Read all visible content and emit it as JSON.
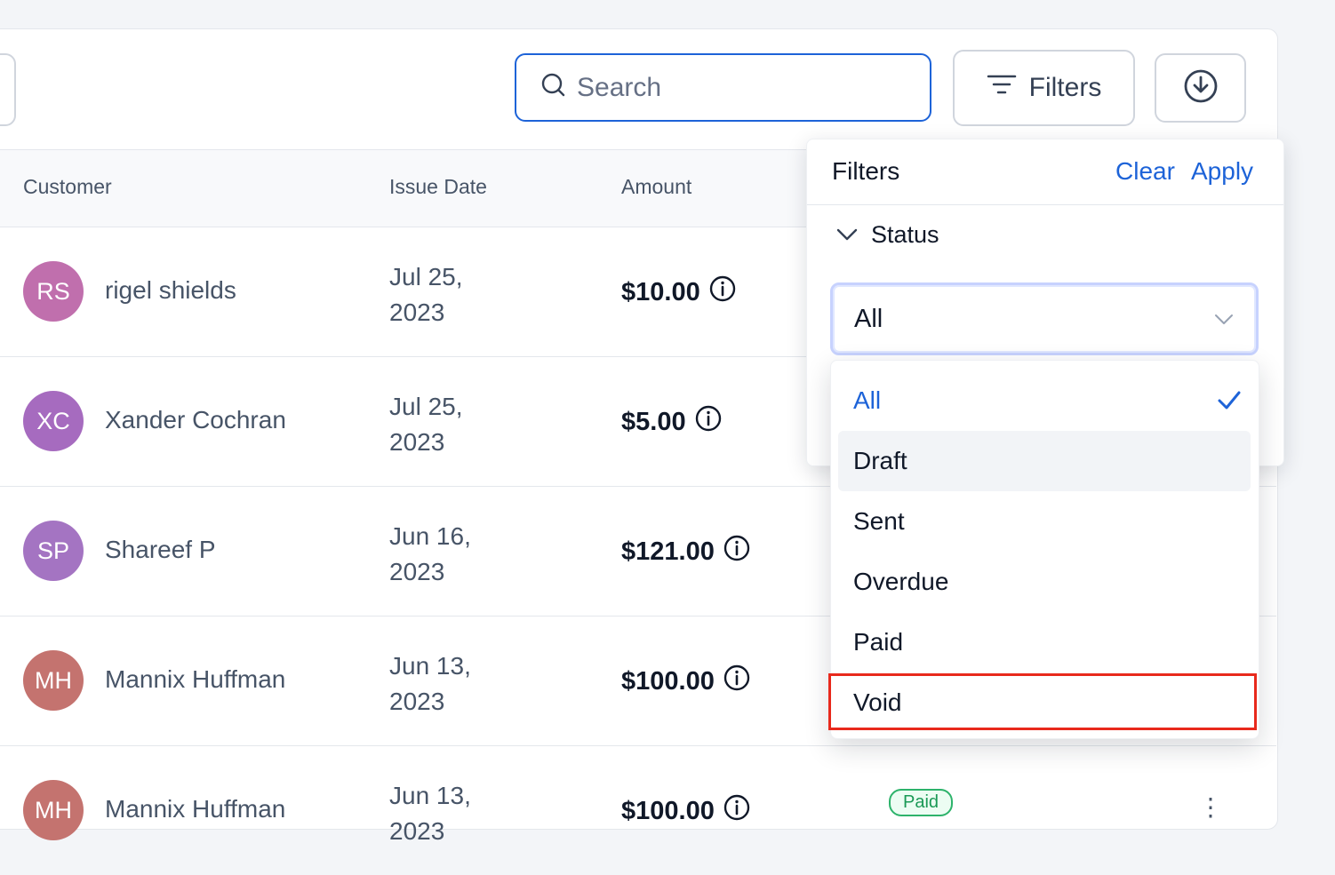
{
  "toolbar": {
    "search_placeholder": "Search",
    "filters_label": "Filters"
  },
  "table": {
    "columns": [
      "Customer",
      "Issue Date",
      "Amount"
    ],
    "rows": [
      {
        "initials": "RS",
        "name": "rigel shields",
        "date_line1": "Jul 25,",
        "date_line2": "2023",
        "amount": "$10.00",
        "avatar_color": "#c06fad"
      },
      {
        "initials": "XC",
        "name": "Xander Cochran",
        "date_line1": "Jul 25,",
        "date_line2": "2023",
        "amount": "$5.00",
        "avatar_color": "#a66bbf"
      },
      {
        "initials": "SP",
        "name": "Shareef P",
        "date_line1": "Jun 16,",
        "date_line2": "2023",
        "amount": "$121.00",
        "avatar_color": "#a474c2"
      },
      {
        "initials": "MH",
        "name": "Mannix Huffman",
        "date_line1": "Jun 13,",
        "date_line2": "2023",
        "amount": "$100.00",
        "avatar_color": "#c4736f"
      },
      {
        "initials": "MH",
        "name": "Mannix Huffman",
        "date_line1": "Jun 13,",
        "date_line2": "2023",
        "amount": "$100.00",
        "avatar_color": "#c4736f",
        "status": "Paid"
      }
    ]
  },
  "filter_panel": {
    "title": "Filters",
    "clear_label": "Clear",
    "apply_label": "Apply",
    "status_label": "Status",
    "select_value": "All",
    "options": [
      "All",
      "Draft",
      "Sent",
      "Overdue",
      "Paid",
      "Void"
    ],
    "selected_option": "All",
    "hovered_option": "Draft",
    "highlighted_option": "Void"
  },
  "colors": {
    "accent": "#1d63d8",
    "highlight": "#e8291c",
    "paid_badge": "#1a9956"
  }
}
